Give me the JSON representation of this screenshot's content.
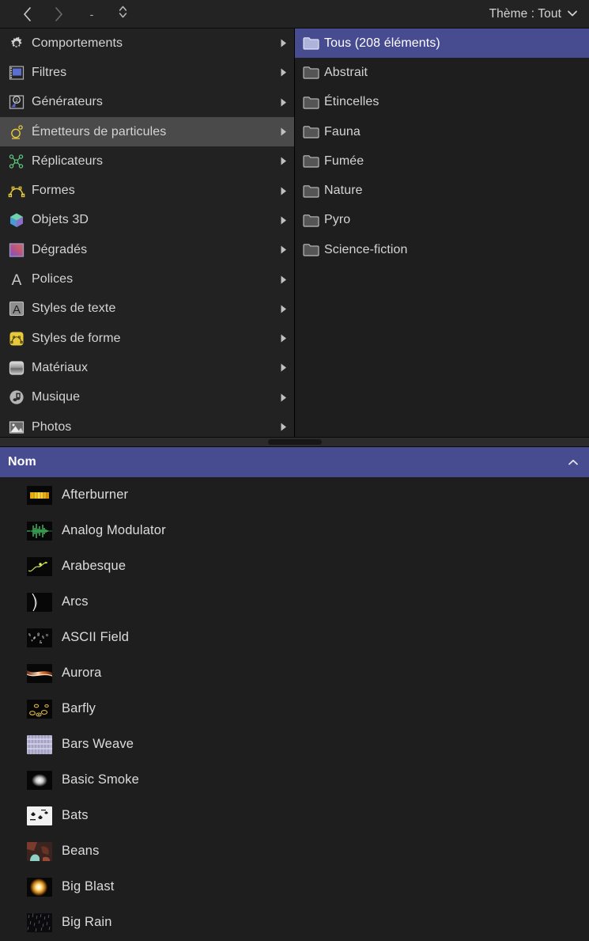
{
  "toolbar": {
    "back_icon": "chevron-left-icon",
    "forward_icon": "chevron-right-icon",
    "path_label": "-",
    "stepper_icon": "stepper-up-down-icon",
    "theme_label": "Thème : Tout",
    "theme_chevron_icon": "chevron-down-icon"
  },
  "categories": [
    {
      "label": "Comportements",
      "icon": "gear-icon",
      "selected": false,
      "has_submenu": true
    },
    {
      "label": "Filtres",
      "icon": "filmstrip-icon",
      "selected": false,
      "has_submenu": true
    },
    {
      "label": "Générateurs",
      "icon": "generator-icon",
      "selected": false,
      "has_submenu": true
    },
    {
      "label": "Émetteurs de particules",
      "icon": "particle-emitter-icon",
      "selected": true,
      "has_submenu": true
    },
    {
      "label": "Réplicateurs",
      "icon": "replicator-icon",
      "selected": false,
      "has_submenu": true
    },
    {
      "label": "Formes",
      "icon": "shape-curve-icon",
      "selected": false,
      "has_submenu": true
    },
    {
      "label": "Objets 3D",
      "icon": "cube-3d-icon",
      "selected": false,
      "has_submenu": true
    },
    {
      "label": "Dégradés",
      "icon": "gradient-icon",
      "selected": false,
      "has_submenu": true
    },
    {
      "label": "Polices",
      "icon": "font-a-icon",
      "selected": false,
      "has_submenu": true
    },
    {
      "label": "Styles de texte",
      "icon": "text-style-icon",
      "selected": false,
      "has_submenu": true
    },
    {
      "label": "Styles de forme",
      "icon": "shape-style-icon",
      "selected": false,
      "has_submenu": true
    },
    {
      "label": "Matériaux",
      "icon": "material-icon",
      "selected": false,
      "has_submenu": true
    },
    {
      "label": "Musique",
      "icon": "music-note-icon",
      "selected": false,
      "has_submenu": true
    },
    {
      "label": "Photos",
      "icon": "photo-icon",
      "selected": false,
      "has_submenu": true
    }
  ],
  "folders": [
    {
      "label": "Tous (208 éléments)",
      "icon": "folder-icon",
      "selected": true
    },
    {
      "label": "Abstrait",
      "icon": "folder-icon",
      "selected": false
    },
    {
      "label": "Étincelles",
      "icon": "folder-icon",
      "selected": false
    },
    {
      "label": "Fauna",
      "icon": "folder-icon",
      "selected": false
    },
    {
      "label": "Fumée",
      "icon": "folder-icon",
      "selected": false
    },
    {
      "label": "Nature",
      "icon": "folder-icon",
      "selected": false
    },
    {
      "label": "Pyro",
      "icon": "folder-icon",
      "selected": false
    },
    {
      "label": "Science-fiction",
      "icon": "folder-icon",
      "selected": false
    }
  ],
  "list_header": {
    "column_label": "Nom",
    "sort_icon": "chevron-up-icon",
    "sort_direction": "ascending"
  },
  "assets": [
    {
      "label": "Afterburner",
      "thumb": "afterburner"
    },
    {
      "label": "Analog Modulator",
      "thumb": "analog-modulator"
    },
    {
      "label": "Arabesque",
      "thumb": "arabesque"
    },
    {
      "label": "Arcs",
      "thumb": "arcs"
    },
    {
      "label": "ASCII Field",
      "thumb": "ascii-field"
    },
    {
      "label": "Aurora",
      "thumb": "aurora"
    },
    {
      "label": "Barfly",
      "thumb": "barfly"
    },
    {
      "label": "Bars Weave",
      "thumb": "bars-weave"
    },
    {
      "label": "Basic Smoke",
      "thumb": "basic-smoke"
    },
    {
      "label": "Bats",
      "thumb": "bats"
    },
    {
      "label": "Beans",
      "thumb": "beans"
    },
    {
      "label": "Big Blast",
      "thumb": "big-blast"
    },
    {
      "label": "Big Rain",
      "thumb": "big-rain"
    }
  ],
  "colors": {
    "background": "#1e1e1e",
    "toolbar": "#232323",
    "pane_left": "#222222",
    "selection_blue": "#474c91",
    "selection_gray": "#4a4a4a",
    "header_blue": "#474c91",
    "text": "#d4d4d4"
  }
}
